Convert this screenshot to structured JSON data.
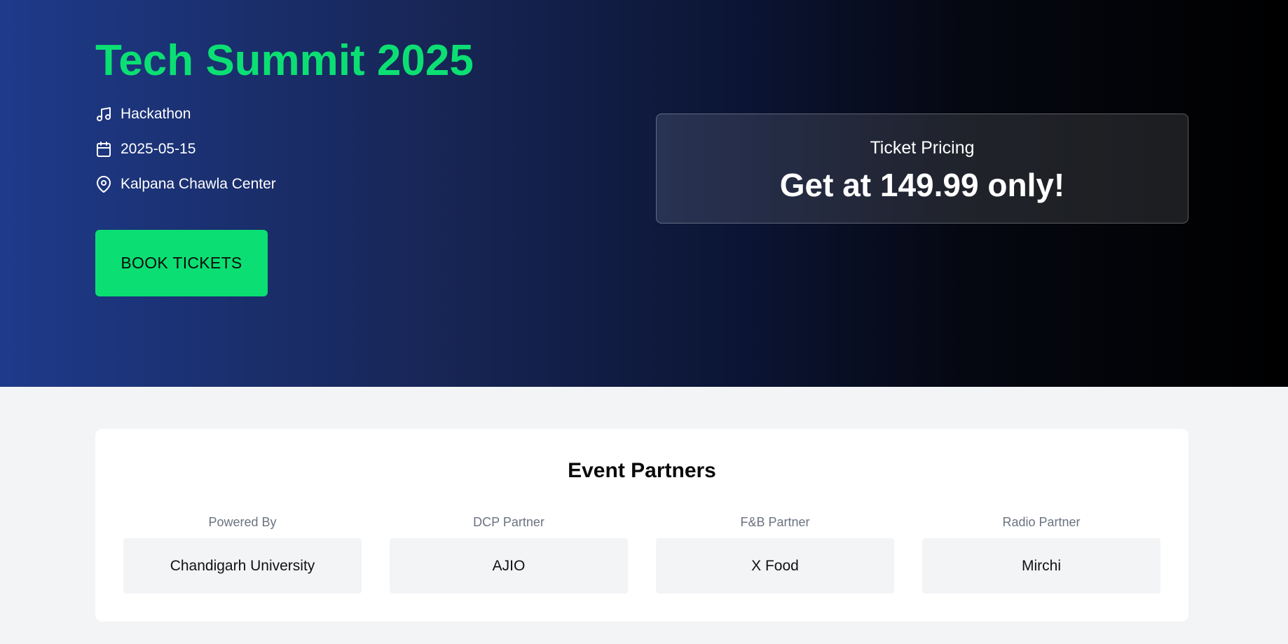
{
  "hero": {
    "title": "Tech Summit 2025",
    "category": "Hackathon",
    "date": "2025-05-15",
    "venue": "Kalpana Chawla Center",
    "book_button_label": "BOOK TICKETS",
    "icons": [
      "music-note-icon",
      "calendar-icon",
      "map-pin-icon"
    ]
  },
  "pricing": {
    "label": "Ticket Pricing",
    "value": "Get at 149.99 only!"
  },
  "partners": {
    "title": "Event Partners",
    "items": [
      {
        "role": "Powered By",
        "name": "Chandigarh University"
      },
      {
        "role": "DCP Partner",
        "name": "AJIO"
      },
      {
        "role": "F&B Partner",
        "name": "X Food"
      },
      {
        "role": "Radio Partner",
        "name": "Mirchi"
      }
    ]
  },
  "colors": {
    "accent": "#0bdf73",
    "hero_gradient_start": "#1e3a8a",
    "hero_gradient_end": "#000000",
    "page_background": "#f3f4f6"
  }
}
